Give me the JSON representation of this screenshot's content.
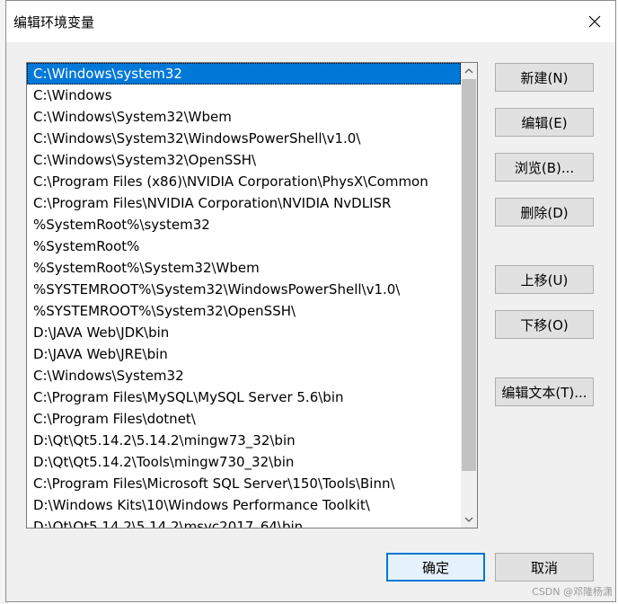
{
  "dialog": {
    "title": "编辑环境变量"
  },
  "paths": [
    "C:\\Windows\\system32",
    "C:\\Windows",
    "C:\\Windows\\System32\\Wbem",
    "C:\\Windows\\System32\\WindowsPowerShell\\v1.0\\",
    "C:\\Windows\\System32\\OpenSSH\\",
    "C:\\Program Files (x86)\\NVIDIA Corporation\\PhysX\\Common",
    "C:\\Program Files\\NVIDIA Corporation\\NVIDIA NvDLISR",
    "%SystemRoot%\\system32",
    "%SystemRoot%",
    "%SystemRoot%\\System32\\Wbem",
    "%SYSTEMROOT%\\System32\\WindowsPowerShell\\v1.0\\",
    "%SYSTEMROOT%\\System32\\OpenSSH\\",
    "D:\\JAVA Web\\JDK\\bin",
    "D:\\JAVA Web\\JRE\\bin",
    "C:\\Windows\\System32",
    "C:\\Program Files\\MySQL\\MySQL Server 5.6\\bin",
    "C:\\Program Files\\dotnet\\",
    "D:\\Qt\\Qt5.14.2\\5.14.2\\mingw73_32\\bin",
    "D:\\Qt\\Qt5.14.2\\Tools\\mingw730_32\\bin",
    "C:\\Program Files\\Microsoft SQL Server\\150\\Tools\\Binn\\",
    "D:\\Windows Kits\\10\\Windows Performance Toolkit\\",
    "D:\\Qt\\Qt5.14.2\\5.14.2\\msvc2017_64\\bin"
  ],
  "selected_index": 0,
  "buttons": {
    "new": "新建(N)",
    "edit": "编辑(E)",
    "browse": "浏览(B)...",
    "delete": "删除(D)",
    "move_up": "上移(U)",
    "move_down": "下移(O)",
    "edit_text": "编辑文本(T)...",
    "ok": "确定",
    "cancel": "取消"
  },
  "watermark": "CSDN @邓隆杨潇",
  "colors": {
    "selection": "#0078d7",
    "default_button_border": "#0078d7"
  }
}
